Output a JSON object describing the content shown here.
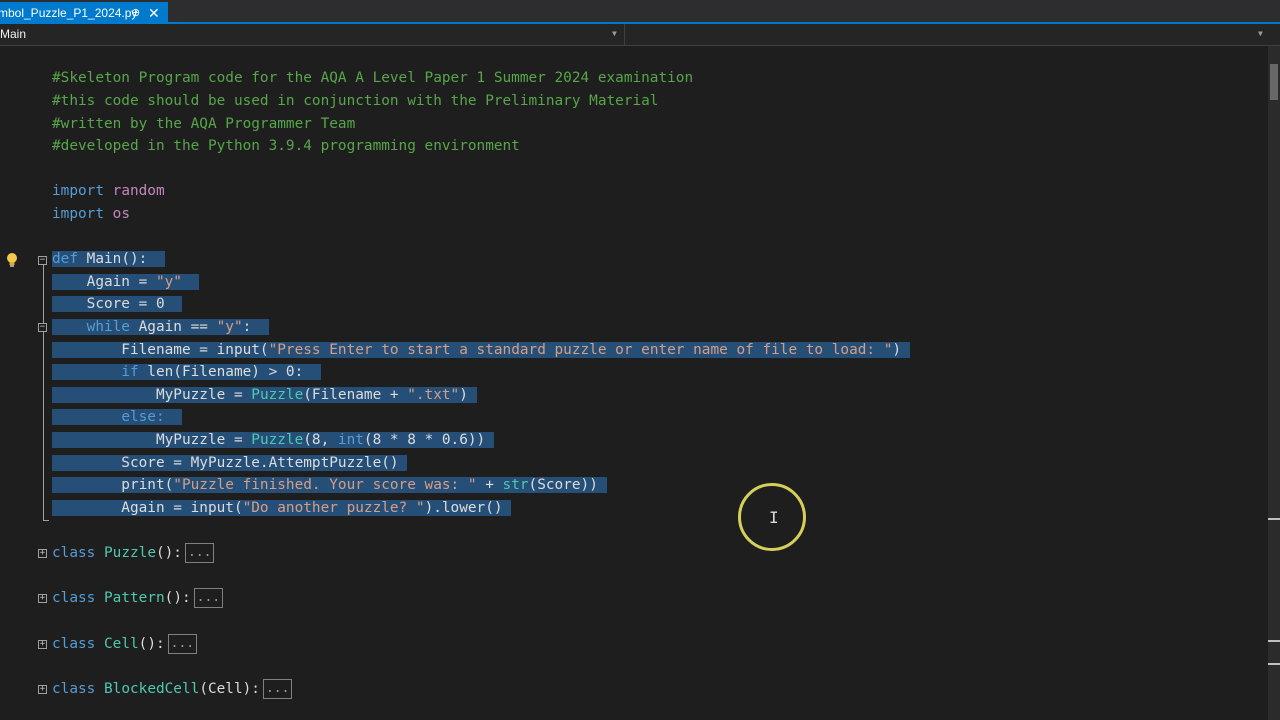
{
  "tab": {
    "filename": "mbol_Puzzle_P1_2024.py",
    "pin_icon": "⊕",
    "close_icon": "✕"
  },
  "navbar": {
    "scope": "Main"
  },
  "code": {
    "l1": "#Skeleton Program code for the AQA A Level Paper 1 Summer 2024 examination",
    "l2": "#this code should be used in conjunction with the Preliminary Material",
    "l3": "#written by the AQA Programmer Team",
    "l4": "#developed in the Python 3.9.4 programming environment",
    "import_kw": "import",
    "mod_random": "random",
    "mod_os": "os",
    "def_kw": "def",
    "main_sig": " Main():",
    "again_assign": "    Again = ",
    "str_y": "\"y\"",
    "score_init": "    Score = 0",
    "while_kw": "while",
    "while_cond": " Again == ",
    "while_colon": ":",
    "filename_assign": "        Filename = input(",
    "prompt1": "\"Press Enter to start a standard puzzle or enter name of file to load: \"",
    "paren_close": ")",
    "if_kw": "if",
    "if_cond": " len(Filename) > 0:",
    "mypuzzle_assign": "            MyPuzzle = ",
    "puzzle_cls": "Puzzle",
    "puzzle_arg1": "(Filename + ",
    "str_txt": "\".txt\"",
    "else_kw": "else:",
    "puzzle_arg2a": "(8, ",
    "int_fn": "int",
    "puzzle_arg2b": "(8 * 8 * 0.6))",
    "score_assign": "        Score = MyPuzzle.AttemptPuzzle()",
    "print_open": "        print(",
    "str_finished": "\"Puzzle finished. Your score was: \"",
    "plus": " + ",
    "str_fn": "str",
    "print_close": "(Score))",
    "again_input": "        Again = input(",
    "str_another": "\"Do another puzzle? \"",
    "lower_call": ").lower()",
    "class_kw": "class",
    "cls_puzzle": "Puzzle",
    "cls_pattern": "Pattern",
    "cls_cell": "Cell",
    "cls_blocked": "BlockedCell",
    "cls_blocked_base": "(Cell):",
    "empty_sig": "():",
    "ellipsis": "..."
  },
  "colors": {
    "accent": "#007acc",
    "selection": "#264f78",
    "comment": "#57a64a",
    "keyword": "#569cd6",
    "string": "#d69d85",
    "class": "#4ec9b0"
  },
  "icons": {
    "lightbulb": "lightbulb-icon",
    "cursor": "mouse-highlight"
  }
}
